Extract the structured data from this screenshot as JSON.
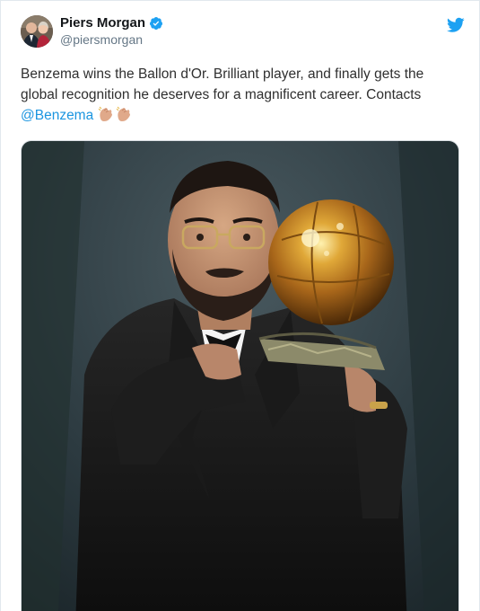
{
  "tweet": {
    "author": {
      "display_name": "Piers Morgan",
      "handle": "@piersmorgan",
      "verified": true,
      "avatar_icon": "profile-photo"
    },
    "platform_icon": "twitter-bird-icon",
    "text_lines": [
      "Benzema wins the Ballon d'Or. Brilliant player, and finally gets the",
      "global recognition he deserves for a magnificent career. Contacts"
    ],
    "mention": "@Benzema",
    "emoji": "clapping-hands-icon",
    "media": {
      "kind": "photo",
      "icon": "ballon-dor-photo"
    }
  },
  "colors": {
    "link": "#1b95e0",
    "verified": "#1da1f2",
    "handle": "#657786",
    "text": "#2f2f2f",
    "border": "#e1e8ed"
  }
}
